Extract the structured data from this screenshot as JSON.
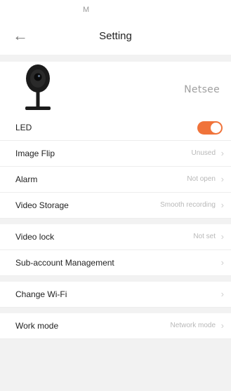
{
  "status_bar": {
    "glyph": "M"
  },
  "header": {
    "title": "Setting",
    "back_icon": "arrow-left-icon"
  },
  "device": {
    "name": "Netsee",
    "icon": "camera-icon"
  },
  "settings": [
    {
      "label": "LED",
      "type": "toggle",
      "on": true,
      "accent": "#f0733a"
    },
    {
      "label": "Image Flip",
      "value": "Unused"
    },
    {
      "label": "Alarm",
      "value": "Not open"
    },
    {
      "label": "Video Storage",
      "value": "Smooth recording"
    },
    {
      "label": "Video lock",
      "value": "Not set"
    },
    {
      "label": "Sub-account Management"
    },
    {
      "label": "Change Wi-Fi"
    },
    {
      "label": "Work mode",
      "value": "Network mode"
    }
  ]
}
